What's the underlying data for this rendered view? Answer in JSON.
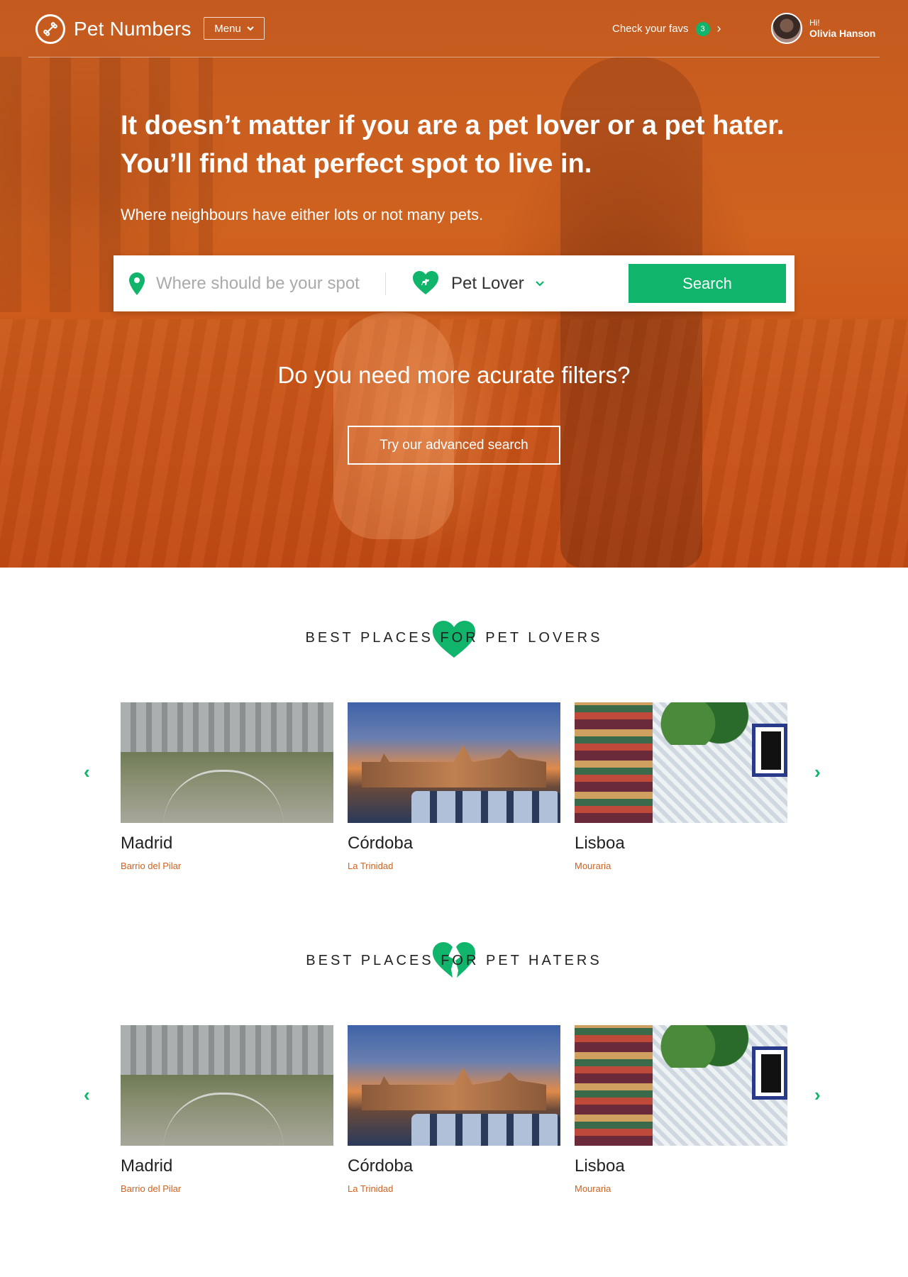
{
  "nav": {
    "logo_text": "Pet Numbers",
    "menu_label": "Menu",
    "favs_label": "Check your favs",
    "favs_count": "3",
    "user_greeting": "Hi!",
    "user_name": "Olivia Hanson"
  },
  "hero": {
    "headline": "It doesn’t matter if you are a pet lover or a pet hater. You’ll find that perfect spot to live in.",
    "subline": "Where neighbours have either lots or not many pets.",
    "search_placeholder": "Where should be your spot",
    "pet_type_value": "Pet Lover",
    "search_button": "Search",
    "filters_question": "Do you need more acurate filters?",
    "advanced_button": "Try our advanced search"
  },
  "lovers": {
    "title": "BEST PLACES FOR PET LOVERS",
    "places": [
      {
        "city": "Madrid",
        "hood": "Barrio del Pilar"
      },
      {
        "city": "Córdoba",
        "hood": "La Trinidad"
      },
      {
        "city": "Lisboa",
        "hood": "Mouraria"
      }
    ]
  },
  "haters": {
    "title": "BEST PLACES FOR PET HATERS",
    "places": [
      {
        "city": "Madrid",
        "hood": "Barrio del Pilar"
      },
      {
        "city": "Córdoba",
        "hood": "La Trinidad"
      },
      {
        "city": "Lisboa",
        "hood": "Mouraria"
      }
    ]
  },
  "colors": {
    "accent_green": "#10b46a",
    "hero_orange": "#d0621f",
    "neighbourhood_text": "#d0621f"
  },
  "icons": {
    "logo": "bone-icon",
    "location": "map-pin-icon",
    "pet_type": "heart-dog-icon",
    "lovers_section": "heart-icon",
    "haters_section": "broken-heart-icon",
    "prev": "chevron-left-icon",
    "next": "chevron-right-icon"
  }
}
